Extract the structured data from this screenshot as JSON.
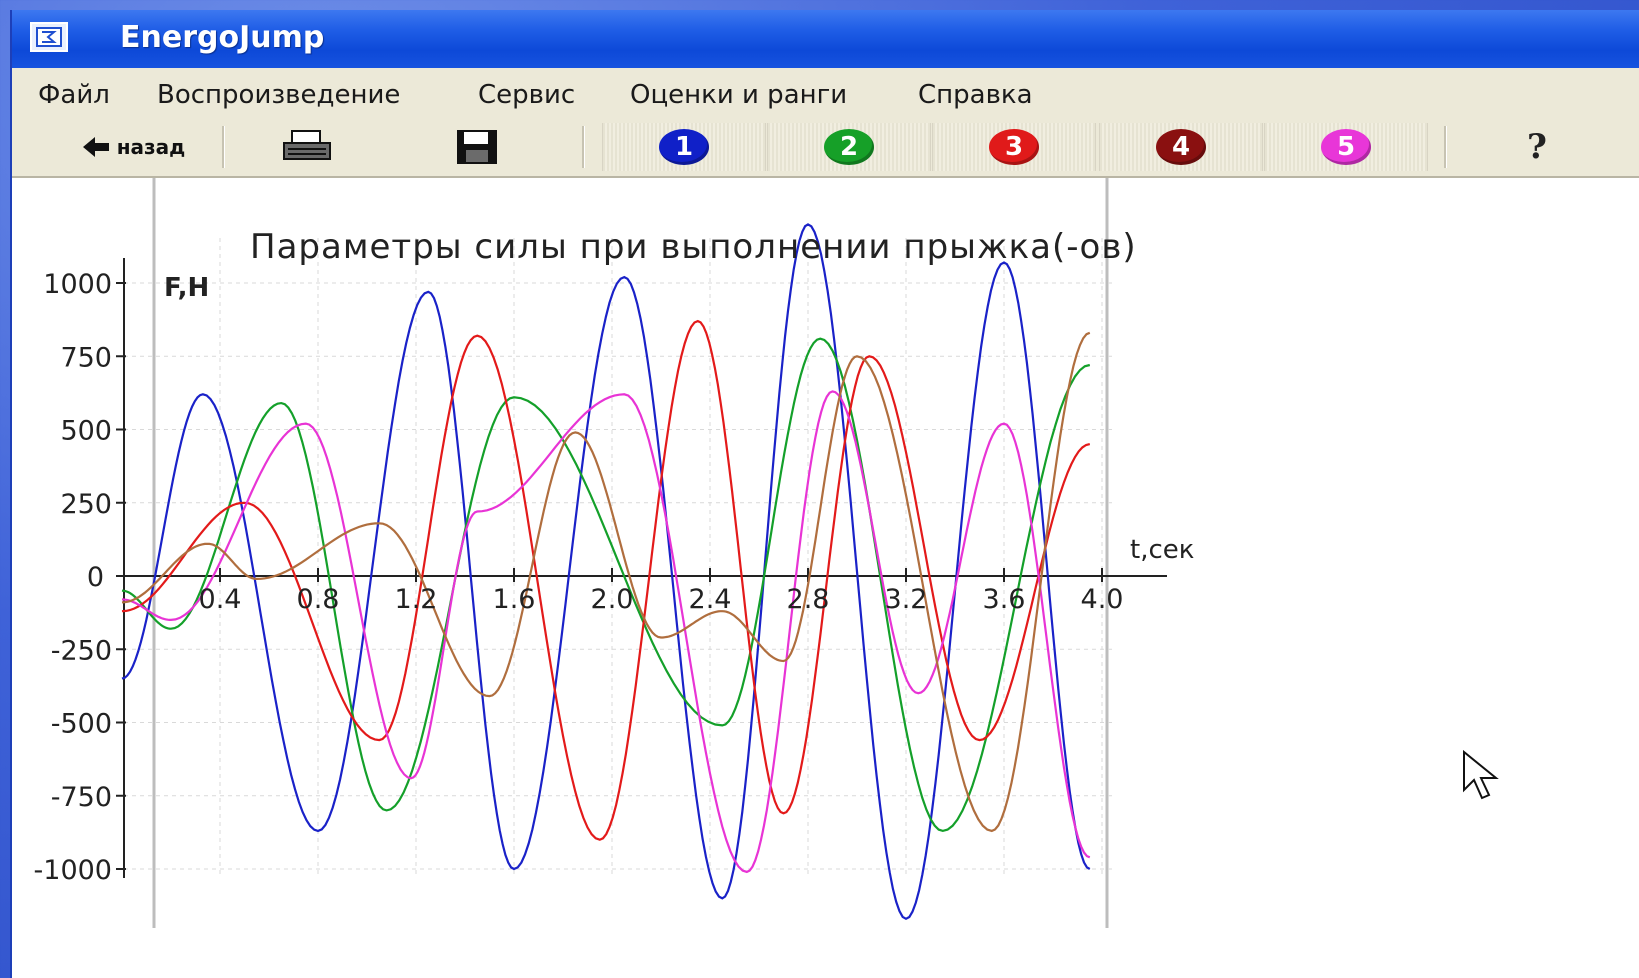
{
  "window": {
    "title": "EnergoJump"
  },
  "menu": {
    "items": [
      "Файл",
      "Воспроизведение",
      "Сервис",
      "Оценки и ранги",
      "Справка"
    ]
  },
  "toolbar": {
    "back_label": "назад",
    "print_icon": "printer-icon",
    "save_icon": "floppy-disk-icon",
    "help_icon": "help-question-icon",
    "jump_buttons": [
      {
        "label": "1",
        "color": "#1020c8"
      },
      {
        "label": "2",
        "color": "#16a028"
      },
      {
        "label": "3",
        "color": "#e01a1a"
      },
      {
        "label": "4",
        "color": "#8a1010"
      },
      {
        "label": "5",
        "color": "#e836d8"
      }
    ]
  },
  "chart_data": {
    "type": "line",
    "title": "Параметры силы при выполнении прыжка(-ов)",
    "xlabel": "t,сек",
    "ylabel": "F,Н",
    "xlim": [
      0.0,
      4.1
    ],
    "ylim": [
      -1000,
      1000
    ],
    "x_ticks": [
      "0.4",
      "0.8",
      "1.2",
      "1.6",
      "2.0",
      "2.4",
      "2.8",
      "3.2",
      "3.6",
      "4.0"
    ],
    "y_ticks": [
      "1000",
      "750",
      "500",
      "250",
      "0",
      "-250",
      "-500",
      "-750",
      "-1000"
    ],
    "grid": true,
    "series": [
      {
        "color": "#1a22c8",
        "values": [
          [
            0.0,
            -350
          ],
          [
            0.33,
            620
          ],
          [
            0.8,
            -870
          ],
          [
            1.25,
            970
          ],
          [
            1.6,
            -1000
          ],
          [
            2.05,
            1020
          ],
          [
            2.45,
            -1100
          ],
          [
            2.8,
            1200
          ],
          [
            3.2,
            -1170
          ],
          [
            3.6,
            1070
          ],
          [
            3.95,
            -1000
          ]
        ]
      },
      {
        "color": "#14a02a",
        "values": [
          [
            0.0,
            -50
          ],
          [
            0.2,
            -180
          ],
          [
            0.65,
            590
          ],
          [
            1.08,
            -800
          ],
          [
            1.6,
            610
          ],
          [
            2.45,
            -510
          ],
          [
            2.85,
            810
          ],
          [
            3.35,
            -870
          ],
          [
            3.95,
            720
          ]
        ]
      },
      {
        "color": "#e31a1a",
        "values": [
          [
            0.0,
            -120
          ],
          [
            0.5,
            250
          ],
          [
            1.05,
            -560
          ],
          [
            1.45,
            820
          ],
          [
            1.95,
            -900
          ],
          [
            2.35,
            870
          ],
          [
            2.7,
            -810
          ],
          [
            3.05,
            750
          ],
          [
            3.5,
            -560
          ],
          [
            3.95,
            450
          ]
        ]
      },
      {
        "color": "#e834d5",
        "values": [
          [
            0.0,
            -80
          ],
          [
            0.2,
            -150
          ],
          [
            0.75,
            520
          ],
          [
            1.18,
            -690
          ],
          [
            1.45,
            220
          ],
          [
            2.05,
            620
          ],
          [
            2.55,
            -1010
          ],
          [
            2.9,
            630
          ],
          [
            3.25,
            -400
          ],
          [
            3.6,
            520
          ],
          [
            3.95,
            -960
          ]
        ]
      },
      {
        "color": "#b06e3e",
        "values": [
          [
            0.0,
            -90
          ],
          [
            0.35,
            110
          ],
          [
            0.55,
            -10
          ],
          [
            1.05,
            180
          ],
          [
            1.5,
            -410
          ],
          [
            1.85,
            490
          ],
          [
            2.2,
            -210
          ],
          [
            2.45,
            -120
          ],
          [
            2.7,
            -290
          ],
          [
            3.0,
            750
          ],
          [
            3.55,
            -870
          ],
          [
            3.95,
            830
          ]
        ]
      }
    ]
  },
  "cursor": {
    "icon": "mouse-pointer-icon"
  }
}
